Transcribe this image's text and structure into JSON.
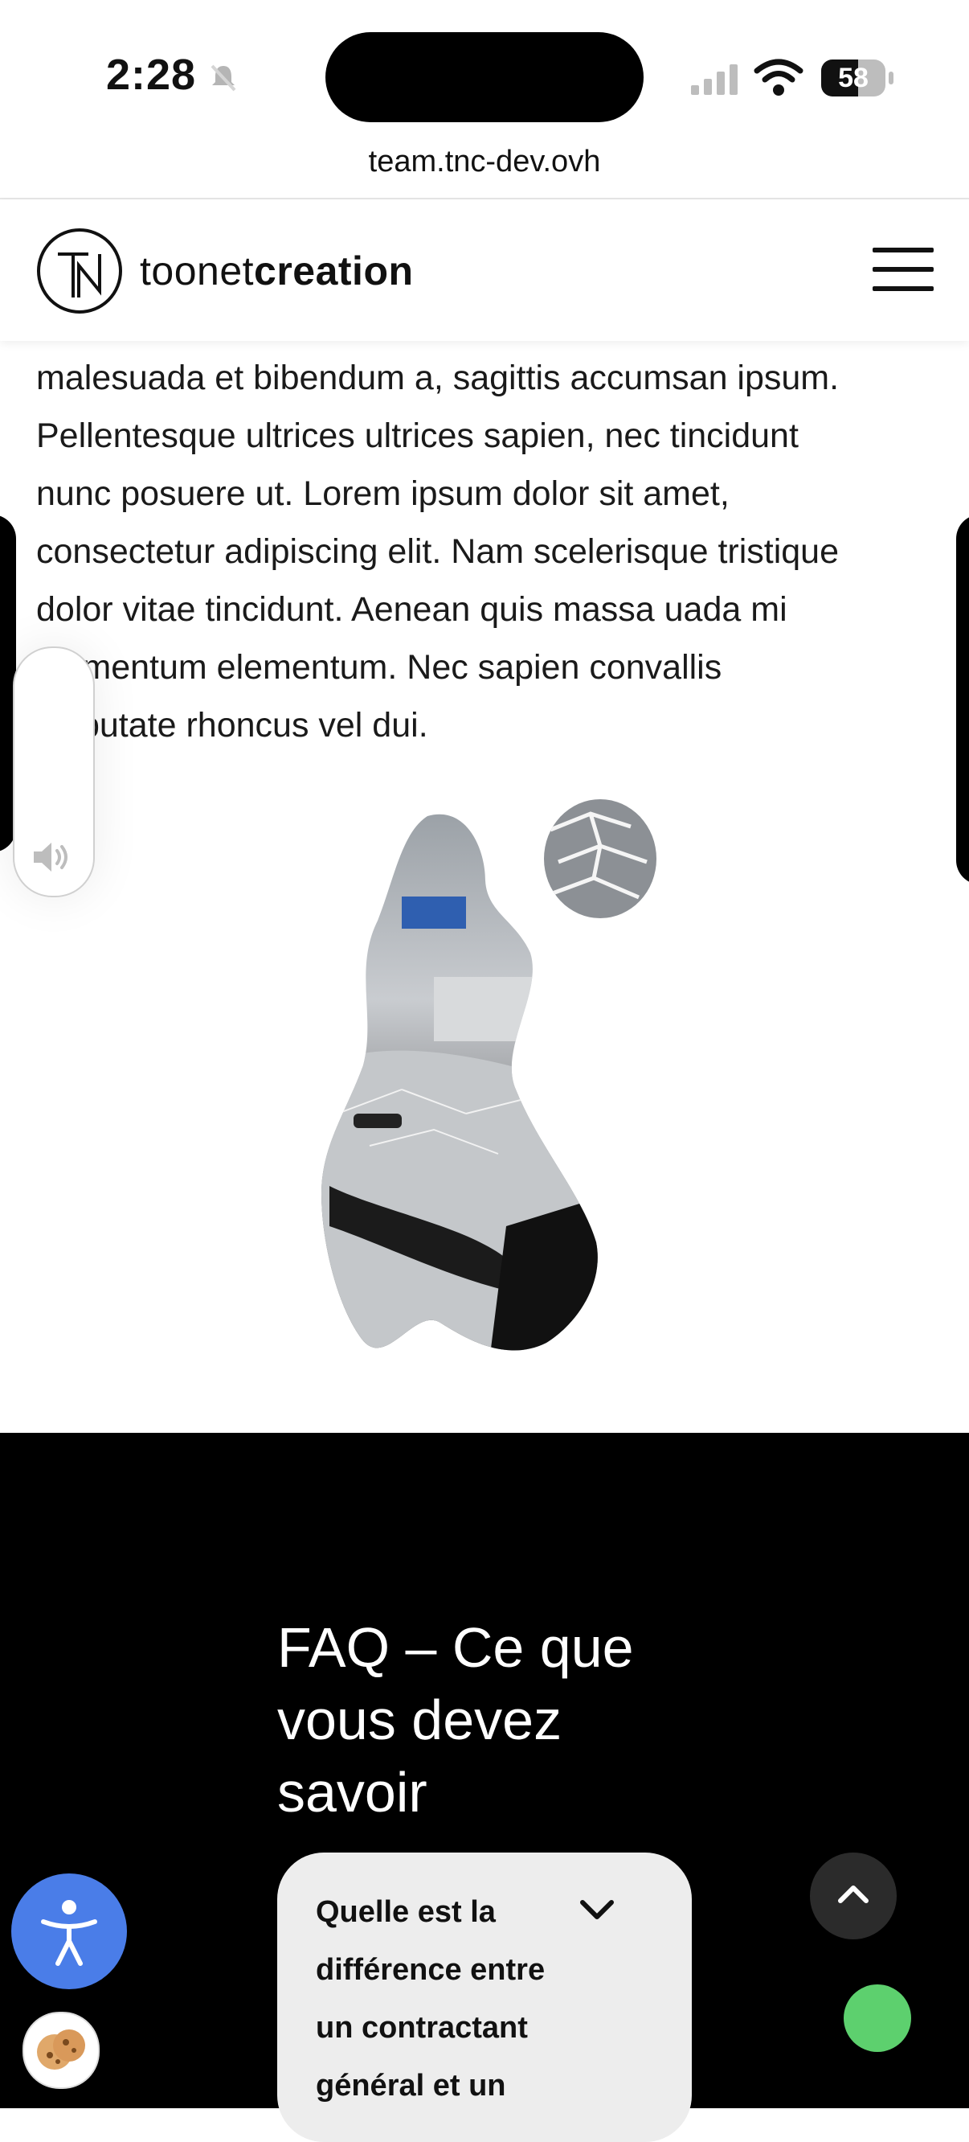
{
  "status_bar": {
    "time": "2:28",
    "battery": "58",
    "battery_level": 0.58
  },
  "browser": {
    "url": "team.tnc-dev.ovh"
  },
  "header": {
    "logo_text_light": "toonet",
    "logo_text_bold": "creation",
    "logo_mark_icon": "tn-logo-icon",
    "menu_icon": "hamburger-menu-icon"
  },
  "article": {
    "lines": [
      "malesuada et bibendum a, sagittis accumsan ipsum.",
      "Pellentesque ultrices ultrices sapien, nec tincidunt",
      "nunc posuere ut. Lorem ipsum dolor sit amet,",
      "consectetur adipiscing elit. Nam scelerisque tristique",
      "dolor vitae tincidunt. Aenean quis massa uada mi",
      "elementum elementum. Nec sapien convallis",
      "vulputate rhoncus vel dui."
    ]
  },
  "sound_widget": {
    "icon": "speaker-icon"
  },
  "faq": {
    "title": "FAQ – Ce que vous devez savoir",
    "items": [
      {
        "question": "Quelle est la différence entre un contractant général et un"
      }
    ]
  },
  "floating": {
    "accessibility_icon": "accessibility-icon",
    "cookie_icon": "cookie-icon",
    "scroll_top_icon": "chevron-up-icon"
  },
  "colors": {
    "accessibility": "#4a7de8",
    "status_dot": "#5dd06e",
    "faq_bg": "#000000",
    "faq_card": "#ededed"
  }
}
